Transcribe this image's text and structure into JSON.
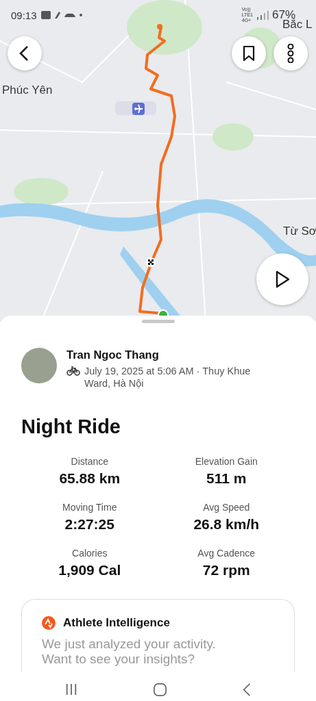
{
  "status_bar": {
    "time": "09:13",
    "network": [
      "Vo))",
      "LTE1",
      "4G+"
    ],
    "battery": "67%"
  },
  "map": {
    "labels": [
      {
        "text": "Phúc Yên"
      },
      {
        "text": "Từ Sơ"
      },
      {
        "text": "Bắc L"
      }
    ]
  },
  "athlete": {
    "name": "Tran Ngoc Thang",
    "meta": "July 19, 2025 at 5:06 AM · Thuy Khue Ward, Hà Nội"
  },
  "activity": {
    "title": "Night Ride",
    "stats": [
      {
        "label": "Distance",
        "value": "65.88 km"
      },
      {
        "label": "Elevation Gain",
        "value": "511 m"
      },
      {
        "label": "Moving Time",
        "value": "2:27:25"
      },
      {
        "label": "Avg Speed",
        "value": "26.8 km/h"
      },
      {
        "label": "Calories",
        "value": "1,909 Cal"
      },
      {
        "label": "Avg Cadence",
        "value": "72 rpm"
      }
    ]
  },
  "insights": {
    "title": "Athlete Intelligence",
    "text": "We just analyzed your activity. Want to see your insights?"
  }
}
